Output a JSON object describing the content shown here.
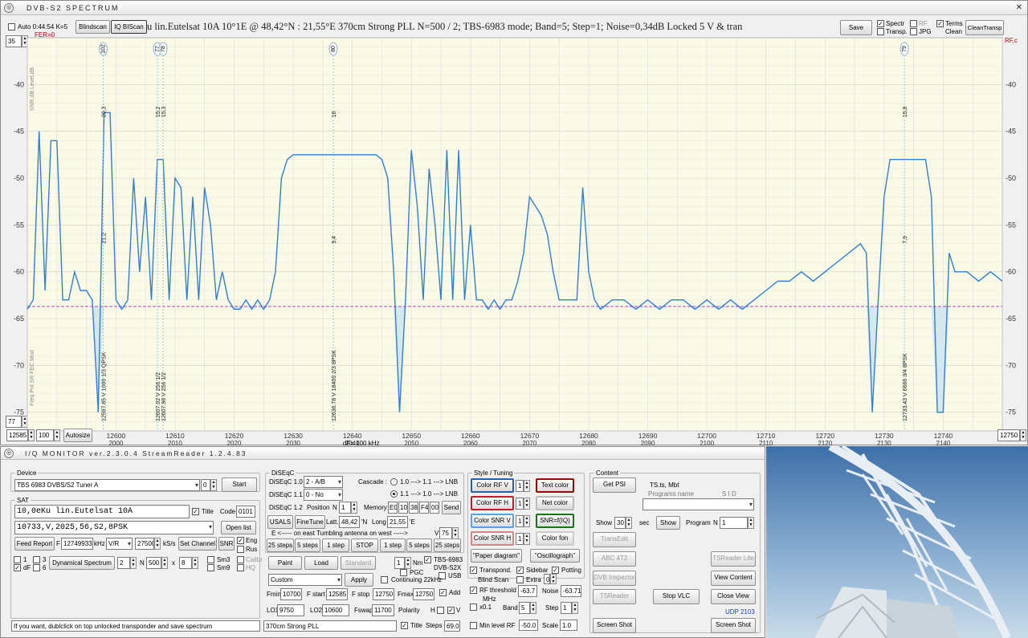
{
  "spectrum_window": {
    "title": "DVB-S2 SPECTRUM",
    "toolbar": {
      "auto_label": "Auto 0:44:54  K=5",
      "blindscan_label": "Blindscan",
      "iqbiscan_label": "IQ BIScan",
      "fer_label": "FER=0",
      "status_text": "u lin.Eutelsat 10A     10°1E  @  48,42°N : 21,55°E      370cm Strong PLL      N=500 / 2; TBS-6983 mode; Band=5; Step=1; Noise=0,34dB      Locked  5 V  & tran",
      "save_label": "Save",
      "spectr_label": "Spectr",
      "transp_label": "Transp.",
      "rf_label": "RF",
      "jpg_label": "JPG",
      "terms_label": "Terms",
      "clean_label": "Clean",
      "cleantransp_label": "CleanTransp"
    },
    "left_scale_top": "35",
    "left_scale_bottom": "77",
    "right_scale_label": "RF,c",
    "bottom_controls": {
      "start_freq": "12585",
      "step_value": "100",
      "autosize_label": "Autosize",
      "end_freq": "12750",
      "df_label": "dF= 100 kHz"
    },
    "vertical_text_left": "SNR,dB  Level,dB",
    "vertical_text_left2": "Freq  Pol  SR  FEC  Mod"
  },
  "chart_data": {
    "type": "line",
    "title": "",
    "xlabel": "",
    "ylabel": "",
    "xlim": [
      12585,
      12750
    ],
    "ylim": [
      -77,
      -35
    ],
    "x_ticks": [
      12600,
      12610,
      12620,
      12630,
      12640,
      12650,
      12660,
      12670,
      12680,
      12690,
      12700,
      12710,
      12720,
      12730,
      12740
    ],
    "x_ticks_secondary": [
      "2000",
      "2010",
      "2020",
      "2030",
      "2040",
      "2050",
      "2060",
      "2070",
      "2080",
      "2090",
      "2100",
      "2110",
      "2120",
      "2130",
      "2140"
    ],
    "y_ticks": [
      -40,
      -45,
      -50,
      -55,
      -60,
      -65,
      -70,
      -75
    ],
    "noise_floor": -63.7,
    "grid": true,
    "colors": {
      "line": "#2f7fd8",
      "fill": "#d7e7ee",
      "noise": "#c040c0",
      "bg": "#fafae6",
      "grid": "#dedede"
    },
    "series": [
      {
        "x": [
          12585,
          12586,
          12587,
          12588,
          12589,
          12590,
          12591,
          12592,
          12593,
          12594,
          12595,
          12596,
          12597,
          12598,
          12599,
          12600,
          12601,
          12602,
          12603,
          12604,
          12605,
          12606,
          12607,
          12608,
          12609,
          12610,
          12611,
          12612,
          12613,
          12614,
          12615,
          12616,
          12617,
          12618,
          12619,
          12620,
          12621,
          12622,
          12623,
          12624,
          12625,
          12626,
          12627,
          12628,
          12629,
          12630,
          12632,
          12634,
          12636,
          12638,
          12640,
          12642,
          12644,
          12645,
          12646,
          12647,
          12648,
          12649,
          12650,
          12651,
          12652,
          12653,
          12654,
          12655,
          12656,
          12657,
          12658,
          12659,
          12660,
          12661,
          12662,
          12663,
          12664,
          12665,
          12666,
          12667,
          12668,
          12669,
          12670,
          12671,
          12672,
          12673,
          12674,
          12675,
          12676,
          12677,
          12678,
          12679,
          12680,
          12681,
          12682,
          12684,
          12686,
          12688,
          12690,
          12692,
          12694,
          12696,
          12698,
          12700,
          12702,
          12704,
          12706,
          12708,
          12710,
          12712,
          12714,
          12716,
          12718,
          12720,
          12722,
          12724,
          12726,
          12727,
          12728,
          12729,
          12730,
          12731,
          12732,
          12734,
          12736,
          12737,
          12738,
          12739,
          12740,
          12741,
          12742,
          12744,
          12746,
          12748,
          12750
        ],
        "y": [
          -64,
          -63,
          -45,
          -62,
          -46,
          -46,
          -63,
          -63,
          -60,
          -62,
          -62,
          -63,
          -75,
          -43,
          -43,
          -63,
          -64,
          -63,
          -50,
          -60,
          -52,
          -63,
          -48,
          -48,
          -63,
          -50,
          -51,
          -63,
          -52,
          -63,
          -51,
          -55,
          -63,
          -60,
          -63,
          -64,
          -64,
          -63,
          -64,
          -63,
          -64,
          -63,
          -60,
          -50,
          -48,
          -47.5,
          -47.5,
          -47.5,
          -47.5,
          -47.5,
          -47.5,
          -47.5,
          -47.5,
          -48,
          -50,
          -60,
          -75,
          -63,
          -47,
          -53,
          -63,
          -49,
          -55,
          -63,
          -47,
          -63,
          -47,
          -63,
          -55,
          -63,
          -63,
          -64,
          -63,
          -64,
          -63,
          -63,
          -61,
          -58,
          -52,
          -53,
          -54,
          -56,
          -60,
          -63,
          -63,
          -63,
          -63,
          -51,
          -60,
          -63,
          -64,
          -63,
          -63,
          -64,
          -63,
          -64,
          -63,
          -63,
          -64,
          -63,
          -64,
          -63,
          -64,
          -63,
          -62,
          -61,
          -61,
          -60,
          -61,
          -60,
          -59,
          -58,
          -57,
          -58,
          -75,
          -63,
          -52,
          -48,
          -48,
          -48,
          -48,
          -48,
          -52,
          -75,
          -75,
          -58,
          -60,
          -60,
          -61,
          -60,
          -61
        ],
        "name": ""
      }
    ],
    "transponders": [
      {
        "marker": "102",
        "freq": 12597.85,
        "pol": "V",
        "sr": "1000",
        "fec": "1/3",
        "mod": "QPSK",
        "level": "20,3",
        "snr": "21,2"
      },
      {
        "marker": "77",
        "freq": 12607.02,
        "pol": "V",
        "sr": "256",
        "fec": "1/2",
        "mod": "",
        "level": "15,2",
        "snr": ""
      },
      {
        "marker": "78",
        "freq": 12607.98,
        "pol": "V",
        "sr": "256",
        "fec": "1/2",
        "mod": "",
        "level": "15,3",
        "snr": ""
      },
      {
        "marker": "80",
        "freq": 12636.78,
        "pol": "V",
        "sr": "18400",
        "fec": "2/3",
        "mod": "8PSK",
        "level": "16",
        "snr": "9,4"
      },
      {
        "marker": "79",
        "freq": 12733.43,
        "pol": "V",
        "sr": "6666",
        "fec": "3/4",
        "mod": "8PSK",
        "level": "15,8",
        "snr": "7,9"
      }
    ]
  },
  "iq_window": {
    "title": "I/Q  MONITOR   ver.2.3.0.4  StreamReader 1.2.4.83",
    "device": {
      "group_label": "Device",
      "device_select": "TBS 6983 DVBS/S2 Tuner A",
      "index_value": "0",
      "start_label": "Start"
    },
    "sat": {
      "group_label": "SAT",
      "sat_name": "10,0eKu lin.Eutelsat 10A",
      "title_label": "Title",
      "code_label": "Code",
      "code_value": "0101",
      "tp_value": "10733,V,2025,56,S2,8PSK",
      "open_list_label": "Open list",
      "feed_report_label": "Feed Report",
      "f_label": "F",
      "freq_value": "12749933",
      "khz_label": "kHz",
      "pol_value": "V/R",
      "sr_value": "27500",
      "ksps_label": "kS/s",
      "set_channel_label": "Set Channel",
      "snr_label": "SNR",
      "eng_label": "Eng",
      "rus_label": "Rus",
      "opt1": "1",
      "opt3": "3",
      "opt6": "6",
      "df_label": "dF",
      "dyn_spectrum_label": "Dynamical Spectrum",
      "dyn_value": "2",
      "n_label": "N",
      "n_value": "500",
      "x_label": "x",
      "x_value": "8",
      "sm3_label": "Sm3",
      "sm9_label": "Sm9",
      "calibr_label": "Calibr",
      "hq_label": "HQ"
    },
    "status_bar": "If you want, dublclick on top unlocked transponder and save spectrum",
    "diseqc": {
      "group_label": "DiSEqC",
      "d10_label": "DiSEqC 1.0",
      "d10_value": "2 - A/B",
      "d11_label": "DiSEqC 1.1",
      "d11_value": "0 - No",
      "d12_label": "DiSEqC 1.2",
      "position_label": "Position",
      "n_label": "N",
      "position_value": "1",
      "memory_label": "Memory",
      "mem_code": [
        "E0",
        "10",
        "38",
        "F4",
        "00"
      ],
      "send_label": "Send",
      "cascade_label": "Cascade :",
      "cascade1": "1.0 ---> 1.1 ---> LNB",
      "cascade2": "1.1 ---> 1.0 ---> LNB",
      "usals_label": "USALS",
      "finetune_label": "FineTune",
      "latt_label": "Latt.",
      "latt_value": "48,42",
      "n_suffix": "'N",
      "long_label": "Long",
      "long_value": "21,55",
      "e_suffix": "'E",
      "east_west_label": "E  <-----  on  east   Tumbling antenna    on  west  ----->",
      "v_label": "V",
      "v_value": "75",
      "step_btns": [
        "25 steps",
        "5 steps",
        "1 step",
        "STOP",
        "1 step",
        "5 steps",
        "25 steps"
      ],
      "paint_label": "Paint",
      "load_label": "Load",
      "standard_label": "Standard",
      "nm_value": "1",
      "nm_label": "Nm",
      "pgc_label": "PGC",
      "tbs_label": "TBS-6983",
      "dvbs2x_label": "DVB-S2X",
      "usb_label": "USB",
      "preset_value": "Custom",
      "apply_label": "Apply",
      "continuing_label": "Continuing 22kHz",
      "fmin_label": "Fmin",
      "fmin_value": "10700",
      "fstart_label": "F start",
      "fstart_value": "12585",
      "fstop_label": "F stop",
      "fstop_value": "12750",
      "fmax_label": "Fmax",
      "fmax_value": "12750",
      "add_label": "Add",
      "lo1_label": "LO1",
      "lo1_value": "9750",
      "lo2_label": "LO2",
      "lo2_value": "10600",
      "fswap_label": "Fswap",
      "fswap_value": "11700",
      "polarity_label": "Polarity",
      "h_label": "H",
      "v2_label": "V",
      "comment_value": "370cm Strong PLL",
      "title_label": "Title",
      "steps_label": "Steps",
      "steps_value": "69.0"
    },
    "style": {
      "group_label": "Style / Tuning",
      "color_rf_v": "Color  RF V",
      "color_rf_h": "Color  RF H",
      "color_snr_v": "Color  SNR V",
      "color_snr_h": "Color  SNR H",
      "val1": "1",
      "val2": "1",
      "val3": "1",
      "val4": "1",
      "text_color": "Text color",
      "net_color": "Net color",
      "snr_fiq": "SNR=f(IQ)",
      "color_fon": "Color fon",
      "paper_diagram": "\"Paper diagram\"",
      "oscillograph": "\"Oscillograph\"",
      "transpond_label": "Transpond.",
      "sidebar_label": "Sidebar",
      "potting_label": "Potting",
      "blind_scan_label": "Blind  Scan",
      "extra_label": "Extra",
      "extra_value": "0",
      "rf_threshold_label": "RF threshold",
      "rf_threshold_value": "-63.7",
      "mhz_label": "MHz",
      "noise_label": "Noise",
      "noise_value": "-63.71",
      "x01_label": "x0.1",
      "band_label": "Band",
      "band_value": "5",
      "step_label": "Step",
      "step_value": "1",
      "min_level_label": "Min level RF",
      "min_level_value": "-50.0",
      "scale_label": "Scale",
      "scale_value": "1.0"
    },
    "content": {
      "group_label": "Content",
      "get_psi": "Get  PSI",
      "ts_label": "TS.ts,  Mbt",
      "programs_name": "Programs  name",
      "sid_label": "S I D",
      "show_label": "Show",
      "show_value": "30",
      "sec_label": "sec",
      "show_btn": "Show",
      "program_label": "Program",
      "n_label": "N",
      "program_value": "1",
      "transedit": "TransEdit",
      "abc4t2": "ABC 4T2",
      "tsreader_lite": "TSReader Lite",
      "dvb_inspector": "DVB Inspector",
      "view_content": "View Content",
      "tsreader": "TSReader",
      "stop_vlc": "Stop  VLC",
      "close_view": "Close View",
      "udp_label": "UDP 2103",
      "screen_shot": "Screen Shot",
      "screen_shot2": "Screen Shot"
    }
  }
}
